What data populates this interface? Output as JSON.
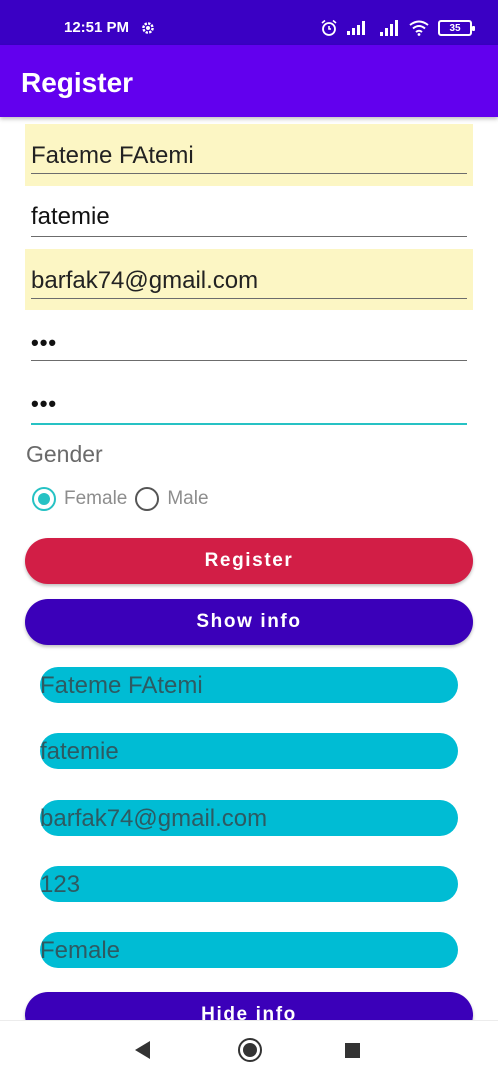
{
  "status_bar": {
    "time": "12:51 PM",
    "battery": "35"
  },
  "app_bar": {
    "title": "Register"
  },
  "form": {
    "name": "Fateme FAtemi",
    "username": "fatemie",
    "email": "barfak74@gmail.com",
    "password": "•••",
    "confirm_password": "•••",
    "gender_label": "Gender",
    "gender_options": [
      "Female",
      "Male"
    ],
    "gender_selected": "Female"
  },
  "buttons": {
    "register": "Register",
    "show_info": "Show info",
    "hide_info": "Hide info"
  },
  "info": {
    "name": "Fateme FAtemi",
    "username": "fatemie",
    "email": "barfak74@gmail.com",
    "password": "123",
    "gender": "Female"
  },
  "colors": {
    "app_bar": "#6200ee",
    "status_bar": "#3a00c4",
    "register_button": "#d21e46",
    "info_button": "#3b00b9",
    "info_pill": "#00bcd4",
    "accent": "#26c2c4",
    "autofill": "#fcf6c4"
  },
  "icons": {
    "settings": "gear-icon",
    "alarm": "alarm-icon",
    "signal": "signal-icon",
    "wifi": "wifi-icon",
    "battery": "battery-icon",
    "back": "back-icon",
    "home": "home-icon",
    "recents": "recents-icon"
  }
}
